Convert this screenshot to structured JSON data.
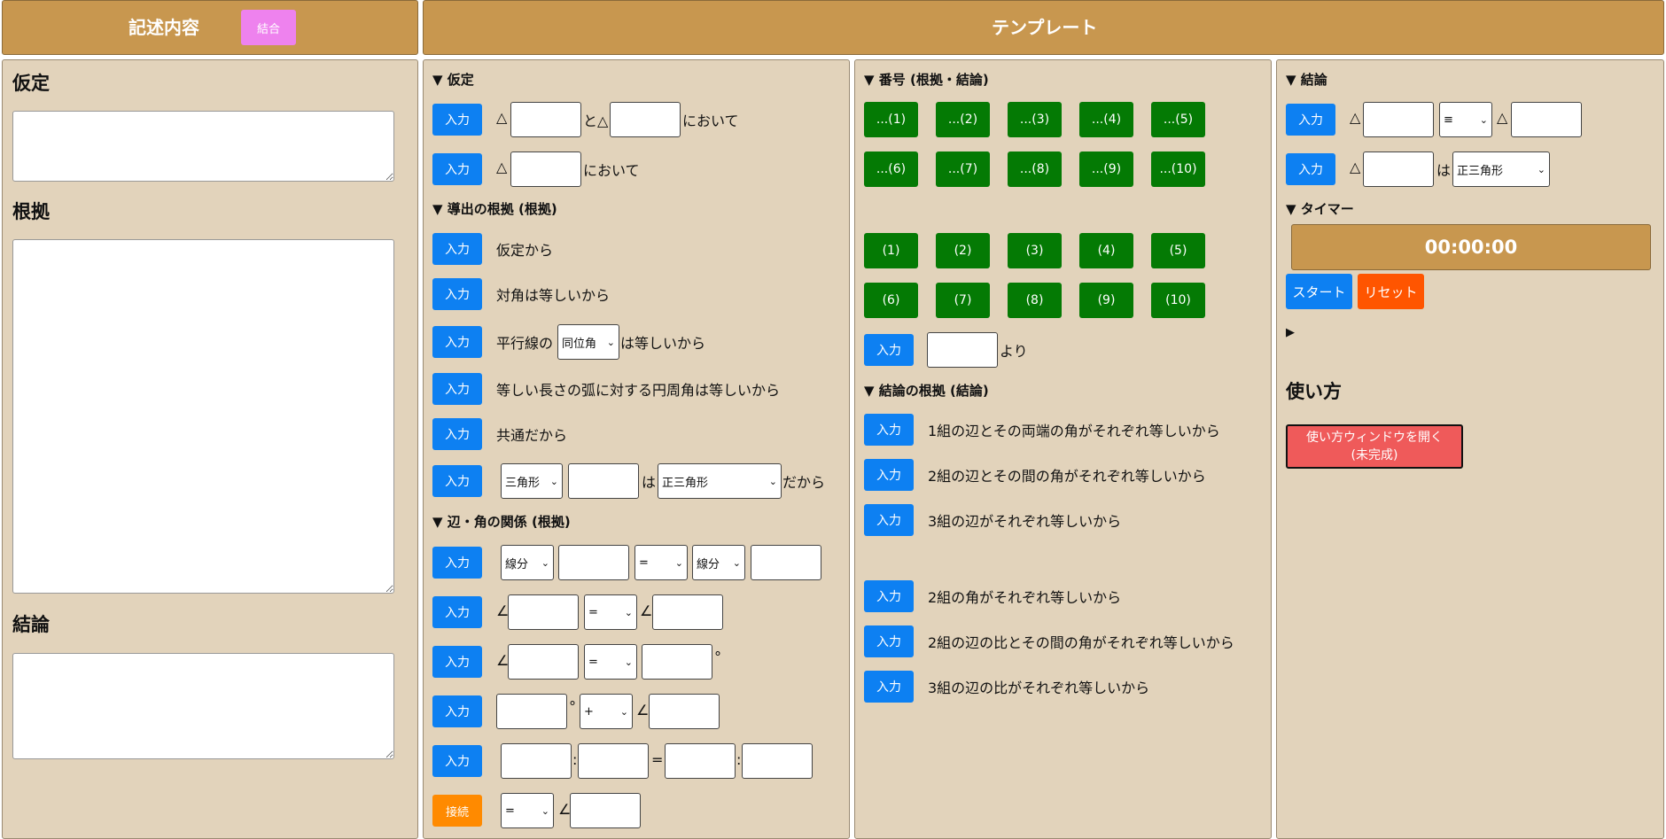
{
  "header": {
    "left_title": "記述内容",
    "combine_label": "結合",
    "right_title": "テンプレート"
  },
  "left": {
    "assumption_title": "仮定",
    "reason_title": "根拠",
    "conclusion_title": "結論"
  },
  "col1": {
    "assumption_head": "▼ 仮定",
    "input_label": "入力",
    "connect_label": "接続",
    "triangle": "△",
    "angle": "∠",
    "to_triangle": "と△",
    "niokite": "において",
    "derivation_head": "▼ 導出の根拠 (根拠)",
    "reasons": [
      "仮定から",
      "対角は等しいから"
    ],
    "parallel_prefix": "平行線の",
    "parallel_select": "同位角",
    "parallel_suffix": "は等しいから",
    "arc_reason": "等しい長さの弧に対する円周角は等しいから",
    "common_reason": "共通だから",
    "shape_select": "三角形",
    "wa": "は",
    "shape_type_select": "正三角形",
    "dakara": "だから",
    "relation_head": "▼ 辺・角の関係 (根拠)",
    "segment_select": "線分",
    "eq_select": "=",
    "plus_select": "+",
    "degree": "°",
    "colon": ":",
    "equals": "="
  },
  "col2": {
    "number_head": "▼ 番号 (根拠・結論)",
    "dots_buttons": [
      "...(1)",
      "...(2)",
      "...(3)",
      "...(4)",
      "...(5)",
      "...(6)",
      "...(7)",
      "...(8)",
      "...(9)",
      "...(10)"
    ],
    "num_buttons": [
      "(1)",
      "(2)",
      "(3)",
      "(4)",
      "(5)",
      "(6)",
      "(7)",
      "(8)",
      "(9)",
      "(10)"
    ],
    "input_label": "入力",
    "yori": "より",
    "conclusion_reason_head": "▼ 結論の根拠 (結論)",
    "reasons": [
      "1組の辺とその両端の角がそれぞれ等しいから",
      "2組の辺とその間の角がそれぞれ等しいから",
      "3組の辺がそれぞれ等しいから",
      "2組の角がそれぞれ等しいから",
      "2組の辺の比とその間の角がそれぞれ等しいから",
      "3組の辺の比がそれぞれ等しいから"
    ]
  },
  "col3": {
    "conclusion_head": "▼ 結論",
    "input_label": "入力",
    "triangle": "△",
    "congruent_select": "≡",
    "wa": "は",
    "shape_type_select": "正三角形",
    "timer_head": "▼ タイマー",
    "timer_value": "00:00:00",
    "start_label": "スタート",
    "reset_label": "リセット",
    "collapsed_marker": "▶",
    "howto_title": "使い方",
    "howto_button_line1": "使い方ウィンドウを開く",
    "howto_button_line2": "(未完成)"
  }
}
